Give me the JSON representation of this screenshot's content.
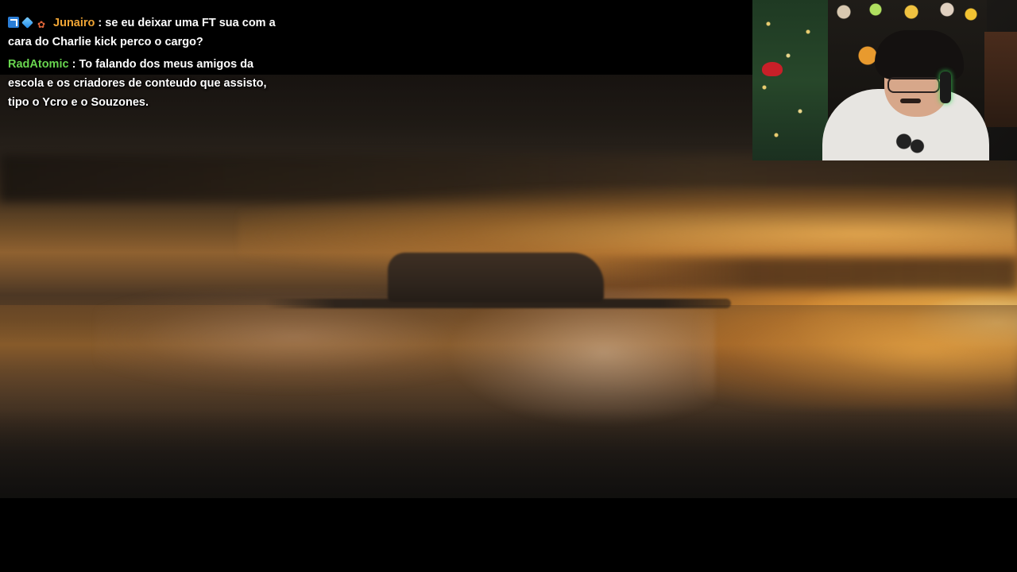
{
  "chat": {
    "messages": [
      {
        "username": "Junairo",
        "username_color": "#f0a535",
        "badges": [
          "prime-arrow-icon",
          "cube-gem-icon",
          "flame-icon"
        ],
        "separator": " : ",
        "text": "se eu deixar uma FT sua com a cara do Charlie kick perco o cargo?"
      },
      {
        "username": "RadAtomic",
        "username_color": "#69d64f",
        "badges": [],
        "separator": " : ",
        "text": "To falando dos meus amigos da escola e os criadores de conteudo que assisto, tipo o Ycro e o Souzones."
      }
    ]
  },
  "colors": {
    "background": "#000000",
    "chat_text": "#ffffff",
    "sunset_highlight": "#ffd27a"
  }
}
